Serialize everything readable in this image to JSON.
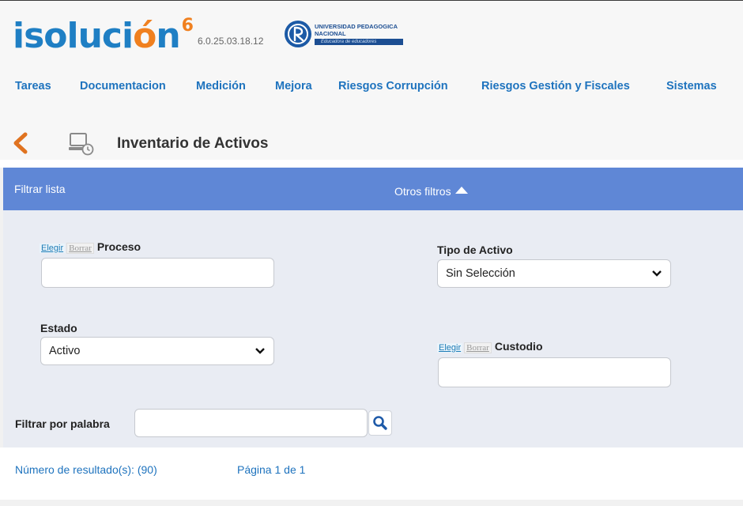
{
  "app": {
    "logo": "isolución",
    "logo_sup": "6",
    "version": "6.0.25.03.18.12",
    "institution_line1": "UNIVERSIDAD PEDAGOGICA",
    "institution_line2": "NACIONAL",
    "institution_motto": "Educadora de educadores"
  },
  "nav": {
    "items": [
      "Tareas",
      "Documentacion",
      "Medición",
      "Mejora",
      "Riesgos Corrupción",
      "Riesgos Gestión y Fiscales",
      "Sistemas"
    ]
  },
  "page": {
    "title": "Inventario de Activos"
  },
  "filter_bar": {
    "label": "Filtrar lista",
    "other_filters": "Otros filtros"
  },
  "filters": {
    "elegir": "Elegir",
    "borrar": "Borrar",
    "proceso_label": "Proceso",
    "proceso_value": "",
    "tipo_label": "Tipo de Activo",
    "tipo_value": "Sin Selección",
    "estado_label": "Estado",
    "estado_value": "Activo",
    "custodio_label": "Custodio",
    "custodio_value": "",
    "palabra_label": "Filtrar por palabra",
    "palabra_value": ""
  },
  "results": {
    "count": "Número de resultado(s): (90)",
    "page": "Página 1 de 1"
  },
  "colors": {
    "accent_blue": "#1e73be",
    "filter_bar": "#5f87d6",
    "logo_orange": "#f0801f"
  }
}
